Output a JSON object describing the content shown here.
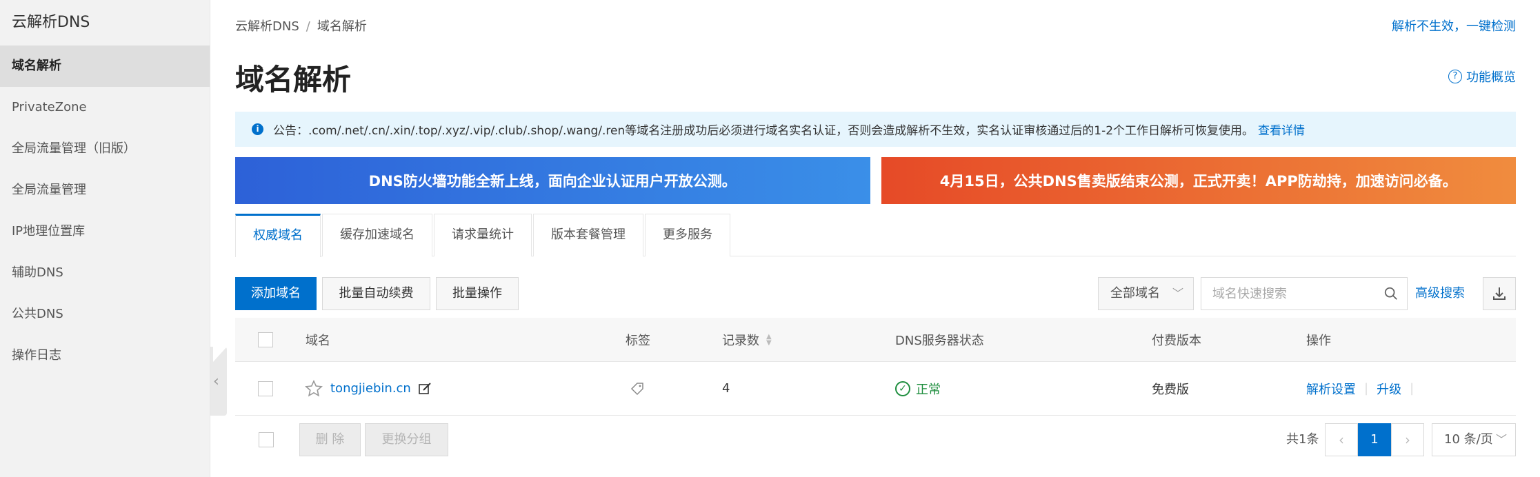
{
  "sidebar": {
    "title": "云解析DNS",
    "items": [
      {
        "label": "域名解析"
      },
      {
        "label": "PrivateZone"
      },
      {
        "label": "全局流量管理（旧版）"
      },
      {
        "label": "全局流量管理"
      },
      {
        "label": "IP地理位置库"
      },
      {
        "label": "辅助DNS"
      },
      {
        "label": "公共DNS"
      },
      {
        "label": "操作日志"
      }
    ]
  },
  "breadcrumb": {
    "root": "云解析DNS",
    "separator": "/",
    "current": "域名解析"
  },
  "top_link": "解析不生效，一键检测",
  "page_title": "域名解析",
  "overview_link": "功能概览",
  "notice": {
    "text": "公告：.com/.net/.cn/.xin/.top/.xyz/.vip/.club/.shop/.wang/.ren等域名注册成功后必须进行域名实名认证，否则会造成解析不生效，实名认证审核通过后的1-2个工作日解析可恢复使用。",
    "link": "查看详情"
  },
  "banners": [
    {
      "text": "DNS防火墙功能全新上线，面向企业认证用户开放公测。"
    },
    {
      "text": "4月15日，公共DNS售卖版结束公测，正式开卖！APP防劫持，加速访问必备。"
    }
  ],
  "tabs": [
    {
      "label": "权威域名"
    },
    {
      "label": "缓存加速域名"
    },
    {
      "label": "请求量统计"
    },
    {
      "label": "版本套餐管理"
    },
    {
      "label": "更多服务"
    }
  ],
  "toolbar": {
    "add_domain": "添加域名",
    "batch_renew": "批量自动续费",
    "batch_ops": "批量操作",
    "filter_value": "全部域名",
    "search_placeholder": "域名快速搜索",
    "advanced_search": "高级搜索"
  },
  "table": {
    "headers": {
      "domain": "域名",
      "tag": "标签",
      "records": "记录数",
      "dns_status": "DNS服务器状态",
      "plan": "付费版本",
      "actions": "操作"
    },
    "rows": [
      {
        "domain": "tongjiebin.cn",
        "records": "4",
        "dns_status": "正常",
        "plan": "免费版",
        "action_settings": "解析设置",
        "action_upgrade": "升级"
      }
    ]
  },
  "footer": {
    "delete": "删 除",
    "change_group": "更换分组",
    "total": "共1条",
    "current_page": "1",
    "page_size": "10 条/页"
  },
  "colors": {
    "accent": "#0070cc",
    "ok": "#1e8e3e"
  }
}
